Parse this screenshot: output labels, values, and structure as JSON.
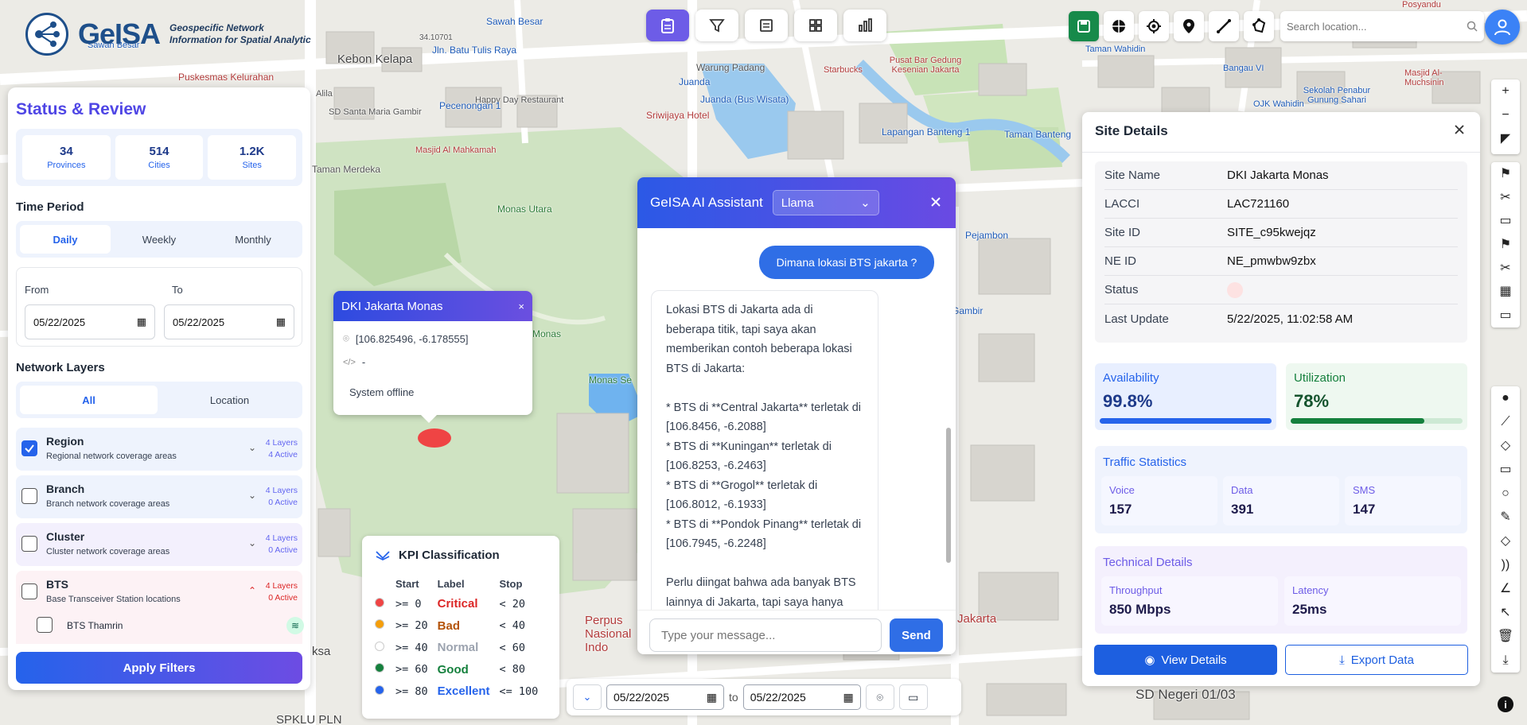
{
  "brand": {
    "name": "GeISA",
    "tagline_line1": "Geospecific Network",
    "tagline_line2": "Information for Spatial Analytic"
  },
  "map": {
    "labels": [
      "Kebon Kelapa",
      "Sawah Besar",
      "Jln. Batu Tulis Raya",
      "34.10701",
      "Puskesmas Kelurahan",
      "Sawah Besar",
      "Warung Padang",
      "Juanda",
      "Juanda (Bus Wisata)",
      "Happy Day Restaurant",
      "SD Santa Maria Gambir",
      "Alila",
      "Sriwijaya Hotel",
      "Pecenongan 1",
      "Masjid Al Mahkamah",
      "Taman Merdeka",
      "Monas Utara",
      "Monas",
      "Monas Se",
      "Starbucks",
      "Pusat Bar Gedung Kesenian Jakarta",
      "Lapangan Banteng 1",
      "Taman Banteng",
      "Taman Wahidin",
      "Bangau VI",
      "Sekolah Penabur Gunung Sahari",
      "Masjid Al-Muchsinin",
      "OJK Wahidin",
      "Posyandu",
      "Pejambon",
      "Gambir",
      "SD Negeri 01/03",
      "SPKLU PLN",
      "Perpus Nasional Indo",
      "Jakarta",
      "ksa"
    ]
  },
  "toolbar": {
    "tools": [
      "clipboard-icon",
      "filter-icon",
      "list-icon",
      "grid-icon",
      "chart-icon"
    ],
    "search_placeholder": "Search location..."
  },
  "left_panel": {
    "title": "Status & Review",
    "stats": [
      {
        "value": "34",
        "label": "Provinces"
      },
      {
        "value": "514",
        "label": "Cities"
      },
      {
        "value": "1.2K",
        "label": "Sites"
      }
    ],
    "time_period": {
      "title": "Time Period",
      "options": [
        "Daily",
        "Weekly",
        "Monthly"
      ],
      "selected": "Daily",
      "from_label": "From",
      "to_label": "To",
      "from_value": "05/22/2025",
      "to_value": "05/22/2025"
    },
    "network_layers": {
      "title": "Network Layers",
      "tabs": [
        "All",
        "Location"
      ],
      "selected": "All",
      "layers": [
        {
          "name": "Region",
          "desc": "Regional network coverage areas",
          "count": "4 Layers",
          "active": "4 Active",
          "checked": true
        },
        {
          "name": "Branch",
          "desc": "Branch network coverage areas",
          "count": "4 Layers",
          "active": "0 Active",
          "checked": false
        },
        {
          "name": "Cluster",
          "desc": "Cluster network coverage areas",
          "count": "4 Layers",
          "active": "0 Active",
          "checked": false
        },
        {
          "name": "BTS",
          "desc": "Base Transceiver Station locations",
          "count": "4 Layers",
          "active": "0 Active",
          "checked": false
        }
      ],
      "sub_item": "BTS Thamrin"
    },
    "apply_label": "Apply Filters"
  },
  "popup": {
    "title": "DKI Jakarta Monas",
    "coords": "[106.825496, -6.178555]",
    "code": "-",
    "status": "System offline"
  },
  "kpi": {
    "title": "KPI Classification",
    "headers": [
      "Start",
      "Label",
      "Stop"
    ],
    "rows": [
      {
        "start": ">= 0",
        "label": "Critical",
        "stop": "< 20",
        "color": "#ef4444"
      },
      {
        "start": ">= 20",
        "label": "Bad",
        "stop": "< 40",
        "color": "#f59e0b"
      },
      {
        "start": ">= 40",
        "label": "Normal",
        "stop": "< 60",
        "color": "#ffffff"
      },
      {
        "start": ">= 60",
        "label": "Good",
        "stop": "< 80",
        "color": "#15803d"
      },
      {
        "start": ">= 80",
        "label": "Excellent",
        "stop": "<= 100",
        "color": "#2563eb"
      }
    ]
  },
  "datebar": {
    "from": "05/22/2025",
    "to_label": "to",
    "to": "05/22/2025"
  },
  "chat": {
    "title": "GeISA AI Assistant",
    "model": "Llama",
    "user_message": "Dimana lokasi BTS jakarta ?",
    "ai_message": "Lokasi BTS di Jakarta ada di beberapa titik, tapi saya akan memberikan contoh beberapa lokasi BTS di Jakarta:\n\n* BTS di **Central Jakarta** terletak di [106.8456, -6.2088]\n* BTS di **Kuningan** terletak di [106.8253, -6.2463]\n* BTS di **Grogol** terletak di [106.8012, -6.1933]\n* BTS di **Pondok Pinang** terletak di [106.7945, -6.2248]\n\nPerlu diingat bahwa ada banyak BTS lainnya di Jakarta, tapi saya hanya",
    "input_placeholder": "Type your message...",
    "send_label": "Send"
  },
  "site": {
    "title": "Site Details",
    "fields": [
      {
        "key": "Site Name",
        "value": "DKI Jakarta Monas"
      },
      {
        "key": "LACCI",
        "value": "LAC721160"
      },
      {
        "key": "Site ID",
        "value": "SITE_c95kwejqz"
      },
      {
        "key": "NE ID",
        "value": "NE_pmwbw9zbx"
      },
      {
        "key": "Status",
        "value": ""
      },
      {
        "key": "Last Update",
        "value": "5/22/2025, 11:02:58 AM"
      }
    ],
    "availability": {
      "label": "Availability",
      "value": "99.8%",
      "fill": 0.998
    },
    "utilization": {
      "label": "Utilization",
      "value": "78%",
      "fill": 0.78
    },
    "traffic": {
      "title": "Traffic Statistics",
      "items": [
        {
          "label": "Voice",
          "value": "157"
        },
        {
          "label": "Data",
          "value": "391"
        },
        {
          "label": "SMS",
          "value": "147"
        }
      ]
    },
    "technical": {
      "title": "Technical Details",
      "items": [
        {
          "label": "Throughput",
          "value": "850 Mbps"
        },
        {
          "label": "Latency",
          "value": "25ms"
        }
      ]
    },
    "view_label": "View Details",
    "export_label": "Export Data"
  },
  "colors": {
    "accent": "#4f46e5",
    "primary": "#2563eb",
    "green": "#178a4a"
  }
}
